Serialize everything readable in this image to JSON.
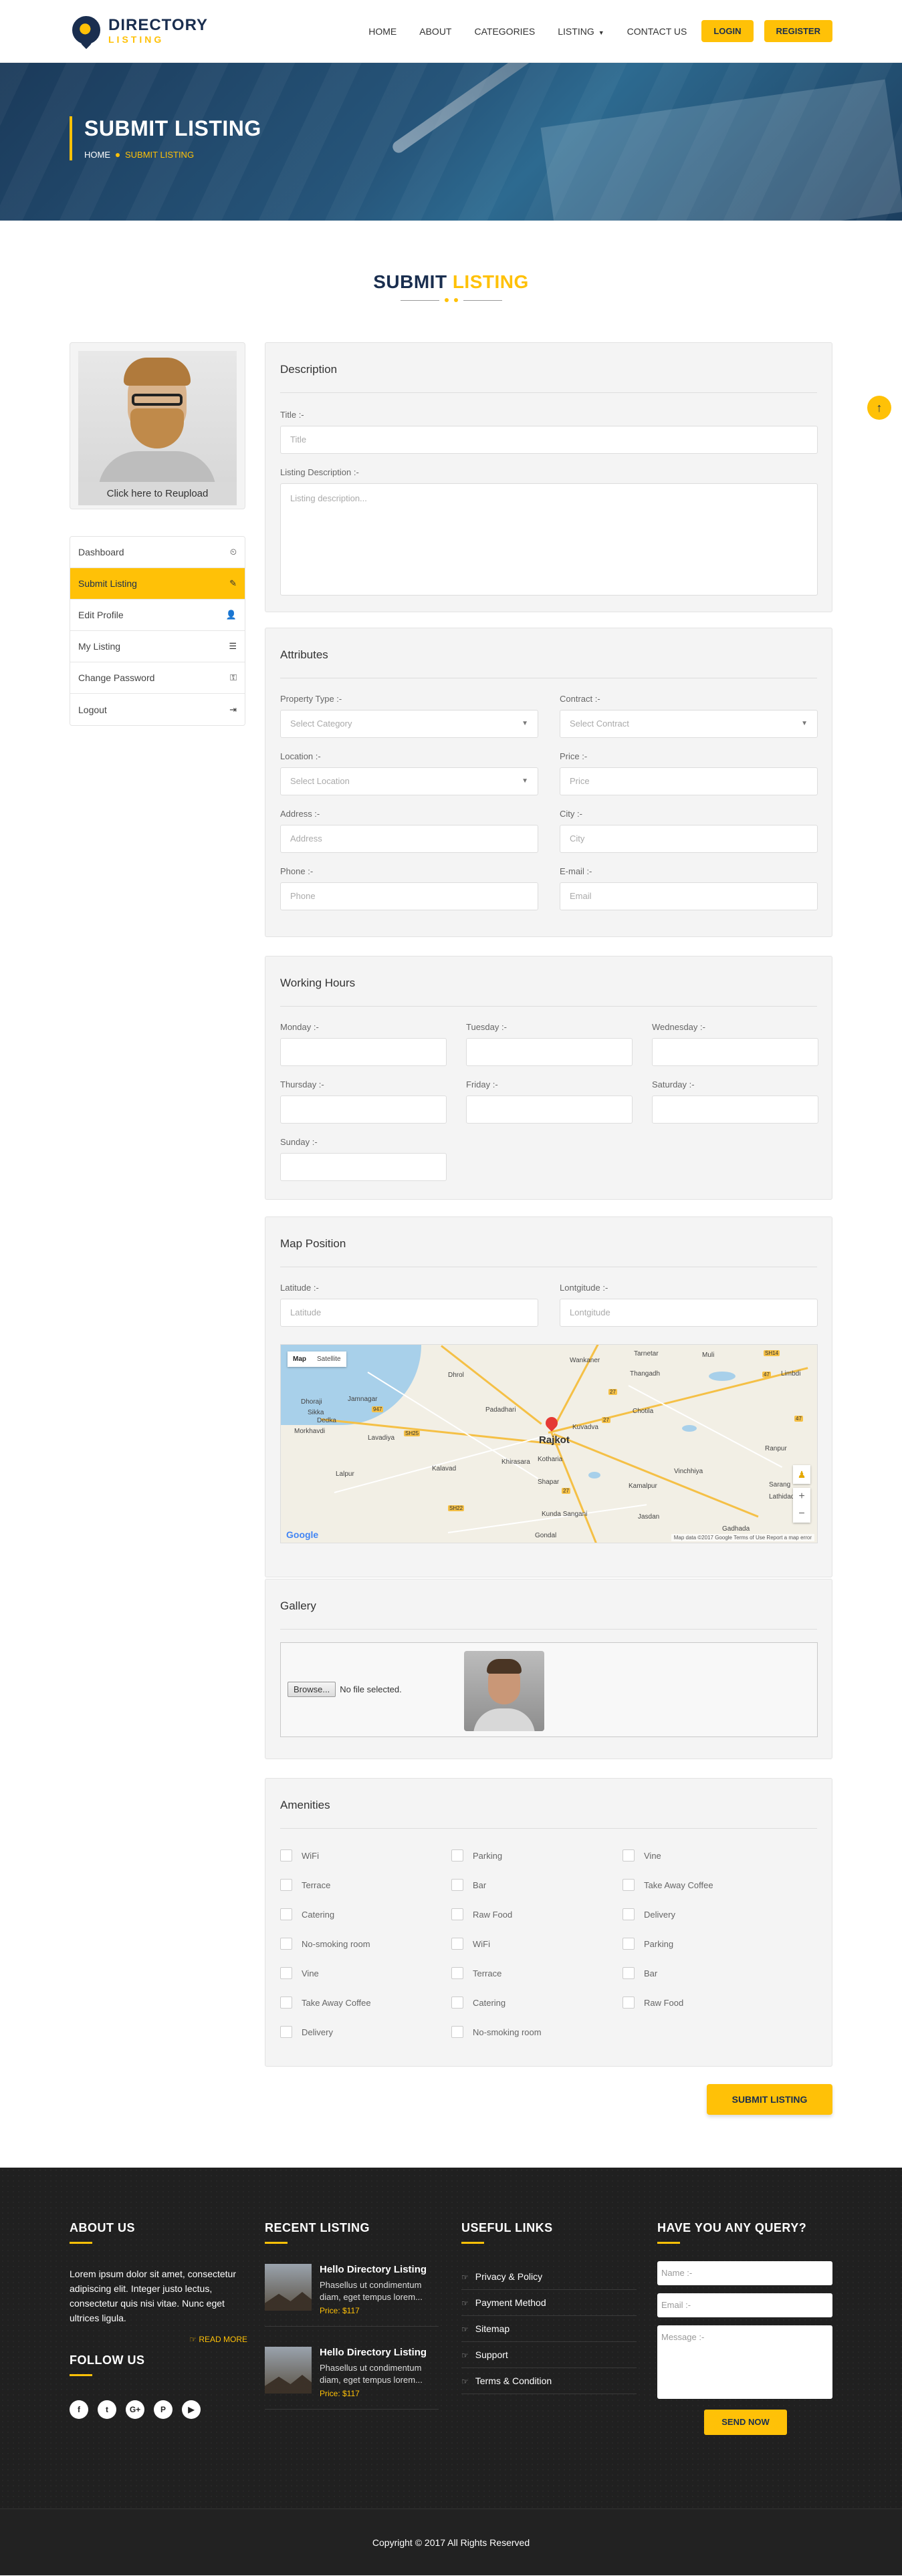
{
  "logo": {
    "line1": "DIRECTORY",
    "line2": "LISTING"
  },
  "nav": {
    "items": [
      "HOME",
      "ABOUT",
      "CATEGORIES",
      "LISTING",
      "CONTACT US"
    ],
    "login": "LOGIN",
    "register": "REGISTER"
  },
  "hero": {
    "title": "SUBMIT LISTING",
    "breadcrumb_home": "HOME",
    "breadcrumb_current": "SUBMIT LISTING"
  },
  "section": {
    "title_part1": "SUBMIT",
    "title_part2": "LISTING"
  },
  "sidebar": {
    "reupload": "Click here to Reupload",
    "menu": [
      {
        "label": "Dashboard",
        "icon": "dashboard-icon",
        "glyph": "⏲"
      },
      {
        "label": "Submit Listing",
        "icon": "pencil-icon",
        "glyph": "✎"
      },
      {
        "label": "Edit Profile",
        "icon": "user-icon",
        "glyph": "👤"
      },
      {
        "label": "My Listing",
        "icon": "list-icon",
        "glyph": "☰"
      },
      {
        "label": "Change Password",
        "icon": "key-icon",
        "glyph": "⚿"
      },
      {
        "label": "Logout",
        "icon": "logout-icon",
        "glyph": "⇥"
      }
    ],
    "active_index": 1
  },
  "description": {
    "heading": "Description",
    "title_label": "Title :-",
    "title_placeholder": "Title",
    "desc_label": "Listing Description :-",
    "desc_placeholder": "Listing description..."
  },
  "attributes": {
    "heading": "Attributes",
    "property_type_label": "Property Type :-",
    "property_type_value": "Select Category",
    "contract_label": "Contract :-",
    "contract_value": "Select Contract",
    "location_label": "Location :-",
    "location_value": "Select Location",
    "price_label": "Price :-",
    "price_placeholder": "Price",
    "address_label": "Address :-",
    "address_placeholder": "Address",
    "city_label": "City :-",
    "city_placeholder": "City",
    "phone_label": "Phone :-",
    "phone_placeholder": "Phone",
    "email_label": "E-mail :-",
    "email_placeholder": "Email"
  },
  "working_hours": {
    "heading": "Working Hours",
    "days": [
      "Monday :-",
      "Tuesday :-",
      "Wednesday :-",
      "Thursday :-",
      "Friday :-",
      "Saturday :-",
      "Sunday :-"
    ]
  },
  "map_position": {
    "heading": "Map Position",
    "lat_label": "Latitude :-",
    "lat_placeholder": "Latitude",
    "lng_label": "Lontgitude :-",
    "lng_placeholder": "Lontgitude",
    "map_tab": "Map",
    "satellite_tab": "Satellite",
    "city": "Rajkot",
    "google": "Google",
    "footer": "Map data ©2017 Google   Terms of Use   Report a map error",
    "towns": [
      "Jamnagar",
      "Dhrol",
      "Wankaner",
      "Tarnetar",
      "Muli",
      "Limbdi",
      "Thangadh",
      "Padadhari",
      "Chotila",
      "Kuvadva",
      "Lalpur",
      "Kalavad",
      "Kotharia",
      "Shapar",
      "Vinchhiya",
      "Kamalpur",
      "Jasdan",
      "Gondal",
      "Sarang",
      "Lathidad",
      "Gadhada",
      "Ranpur",
      "Dedka",
      "Dhoraji",
      "Lavadiya",
      "Sikka",
      "Morkhavdi",
      "Khirasara",
      "Kunda Sangani"
    ]
  },
  "gallery": {
    "heading": "Gallery",
    "browse": "Browse...",
    "no_file": "No file selected."
  },
  "amenities": {
    "heading": "Amenities",
    "columns": [
      [
        "WiFi",
        "Terrace",
        "Catering",
        "No-smoking room",
        "Vine",
        "Take Away Coffee",
        "Delivery"
      ],
      [
        "Parking",
        "Bar",
        "Raw Food",
        "WiFi",
        "Terrace",
        "Catering",
        "No-smoking room"
      ],
      [
        "Vine",
        "Take Away Coffee",
        "Delivery",
        "Parking",
        "Bar",
        "Raw Food"
      ]
    ]
  },
  "submit_button": "SUBMIT LISTING",
  "footer": {
    "about_heading": "ABOUT US",
    "about_text": "Lorem ipsum dolor sit amet, consectetur adipiscing elit. Integer justo lectus, consectetur quis nisi vitae. Nunc eget ultrices ligula.",
    "read_more": "READ MORE",
    "follow_heading": "FOLLOW US",
    "social": [
      {
        "icon": "facebook-icon",
        "glyph": "f"
      },
      {
        "icon": "twitter-icon",
        "glyph": "t"
      },
      {
        "icon": "google-plus-icon",
        "glyph": "G+"
      },
      {
        "icon": "pinterest-icon",
        "glyph": "P"
      },
      {
        "icon": "youtube-icon",
        "glyph": "▶"
      }
    ],
    "recent_heading": "RECENT LISTING",
    "recent": [
      {
        "title": "Hello Directory Listing",
        "desc": "Phasellus ut condimentum diam, eget tempus lorem...",
        "price": "Price: $117"
      },
      {
        "title": "Hello Directory Listing",
        "desc": "Phasellus ut condimentum diam, eget tempus lorem...",
        "price": "Price: $117"
      }
    ],
    "links_heading": "USEFUL LINKS",
    "links": [
      "Privacy & Policy",
      "Payment Method",
      "Sitemap",
      "Support",
      "Terms & Condition"
    ],
    "query_heading": "HAVE YOU ANY QUERY?",
    "name_placeholder": "Name :-",
    "email_placeholder": "Email :-",
    "message_placeholder": "Message :-",
    "send": "SEND NOW"
  },
  "copyright": "Copyright © 2017 All Rights Reserved",
  "colors": {
    "accent": "#ffc107",
    "brand": "#1a2e4f",
    "footer_bg": "#202020"
  }
}
